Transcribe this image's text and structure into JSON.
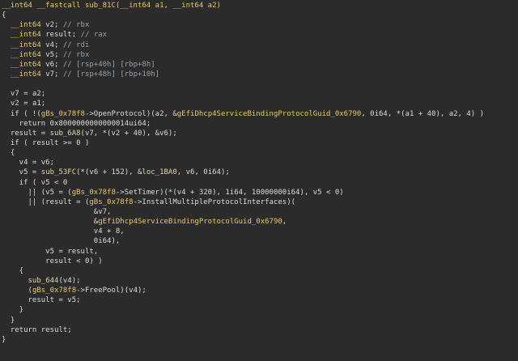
{
  "lines": [
    [
      [
        "type",
        "__int64 __fastcall sub_81C(__int64 a1, __int64 a2)"
      ]
    ],
    [
      [
        "text",
        "{"
      ]
    ],
    [
      [
        "text",
        "  "
      ],
      [
        "type",
        "__int64"
      ],
      [
        "text",
        " v2; "
      ],
      [
        "comment",
        "// rbx"
      ]
    ],
    [
      [
        "text",
        "  "
      ],
      [
        "type",
        "__int64"
      ],
      [
        "text",
        " result; "
      ],
      [
        "comment",
        "// rax"
      ]
    ],
    [
      [
        "text",
        "  "
      ],
      [
        "type",
        "__int64"
      ],
      [
        "text",
        " v4; "
      ],
      [
        "comment",
        "// rdi"
      ]
    ],
    [
      [
        "text",
        "  "
      ],
      [
        "type",
        "__int64"
      ],
      [
        "text",
        " v5; "
      ],
      [
        "comment",
        "// rbx"
      ]
    ],
    [
      [
        "text",
        "  "
      ],
      [
        "type",
        "__int64"
      ],
      [
        "text",
        " v6; "
      ],
      [
        "comment",
        "// [rsp+40h] [rbp+8h]"
      ]
    ],
    [
      [
        "text",
        "  "
      ],
      [
        "type",
        "__int64"
      ],
      [
        "text",
        " v7; "
      ],
      [
        "comment",
        "// [rsp+48h] [rbp+10h]"
      ]
    ],
    [
      [
        "text",
        ""
      ]
    ],
    [
      [
        "text",
        "  v7 = a2;"
      ]
    ],
    [
      [
        "text",
        "  v2 = a1;"
      ]
    ],
    [
      [
        "text",
        "  if ( !("
      ],
      [
        "global",
        "gBs_0x78f8"
      ],
      [
        "text",
        "->OpenProtocol)(a2, &"
      ],
      [
        "global",
        "gEfiDhcp4ServiceBindingProtocolGuid_0x6790"
      ],
      [
        "text",
        ", 0i64, *(a1 + 40), a2, 4) )"
      ]
    ],
    [
      [
        "text",
        "    return 0x8000000000000014ui64;"
      ]
    ],
    [
      [
        "text",
        "  result = "
      ],
      [
        "func",
        "sub_6A8"
      ],
      [
        "text",
        "(v7, *(v2 + 40), &v6);"
      ]
    ],
    [
      [
        "text",
        "  if ( result >= 0 )"
      ]
    ],
    [
      [
        "text",
        "  {"
      ]
    ],
    [
      [
        "text",
        "    v4 = v6;"
      ]
    ],
    [
      [
        "text",
        "    v5 = "
      ],
      [
        "func",
        "sub_53FC"
      ],
      [
        "text",
        "(*(v6 + 152), &"
      ],
      [
        "func",
        "loc_1BA0"
      ],
      [
        "text",
        ", v6, 0i64);"
      ]
    ],
    [
      [
        "text",
        "    if ( v5 < 0"
      ]
    ],
    [
      [
        "text",
        "      || (v5 = ("
      ],
      [
        "global",
        "gBs_0x78f8"
      ],
      [
        "text",
        "->SetTimer)(*(v4 + 320), 1i64, 10000000i64), v5 < 0)"
      ]
    ],
    [
      [
        "text",
        "      || (result = ("
      ],
      [
        "global",
        "gBs_0x78f8"
      ],
      [
        "text",
        "->InstallMultipleProtocolInterfaces)("
      ]
    ],
    [
      [
        "text",
        "                     &v7,"
      ]
    ],
    [
      [
        "text",
        "                     &"
      ],
      [
        "global",
        "gEfiDhcp4ServiceBindingProtocolGuid_0x6790"
      ],
      [
        "text",
        ","
      ]
    ],
    [
      [
        "text",
        "                     v4 + 8,"
      ]
    ],
    [
      [
        "text",
        "                     0i64),"
      ]
    ],
    [
      [
        "text",
        "          v5 = result,"
      ]
    ],
    [
      [
        "text",
        "          result < 0) )"
      ]
    ],
    [
      [
        "text",
        "    {"
      ]
    ],
    [
      [
        "text",
        "      "
      ],
      [
        "func",
        "sub_644"
      ],
      [
        "text",
        "(v4);"
      ]
    ],
    [
      [
        "text",
        "      ("
      ],
      [
        "global",
        "gBs_0x78f8"
      ],
      [
        "text",
        "->FreePool)(v4);"
      ]
    ],
    [
      [
        "text",
        "      result = v5;"
      ]
    ],
    [
      [
        "text",
        "    }"
      ]
    ],
    [
      [
        "text",
        "  }"
      ]
    ],
    [
      [
        "text",
        "  return result;"
      ]
    ],
    [
      [
        "text",
        "}"
      ]
    ]
  ],
  "colors": {
    "background": "#2b2b2b",
    "default_text": "#dcdcdc",
    "type_keyword": "#e8c86a",
    "comment": "#9aa0a6",
    "function_name": "#e0d4a8",
    "global_name": "#e8c86a"
  }
}
